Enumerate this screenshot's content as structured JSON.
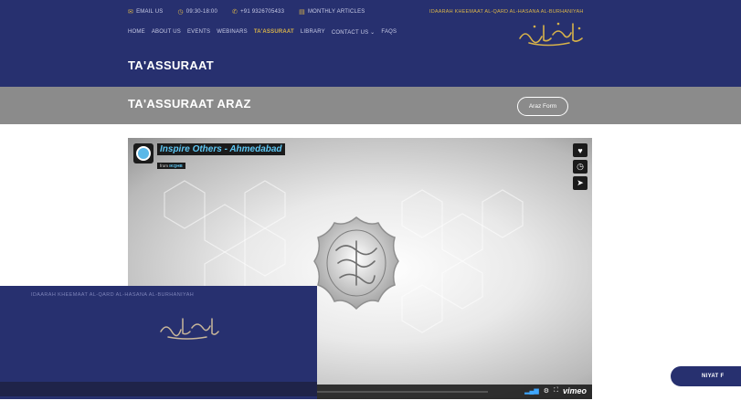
{
  "topbar": {
    "email": "EMAIL US",
    "hours": "09:30-18:00",
    "phone": "+91 9326705433",
    "articles": "MONTHLY ARTICLES",
    "org": "IDAARAH KHEEMAAT AL-QARD AL-HASANA AL-BURHANIYAH"
  },
  "nav": {
    "items": [
      "HOME",
      "ABOUT US",
      "EVENTS",
      "WEBINARS",
      "TA'ASSURAAT",
      "LIBRARY",
      "CONTACT US ⌄",
      "FAQS"
    ]
  },
  "page_title": "TA'ASSURAAT",
  "band": {
    "title": "TA'ASSURAAT ARAZ",
    "button": "Araz Form"
  },
  "video": {
    "title": "Inspire Others - Ahmedabad",
    "from_label": "from",
    "from_name": "IKQHB",
    "brand": "vimeo"
  },
  "overlay": {
    "top_text": "IDAARAH KHEEMAAT AL-QARD AL-HASANA AL-BURHANIYAH"
  },
  "niyat": "NIYAT F",
  "colors": {
    "navy": "#27306f",
    "gold": "#d7b24a",
    "band_gray": "#8b8b8b",
    "vimeo_blue": "#5ec6f2"
  }
}
